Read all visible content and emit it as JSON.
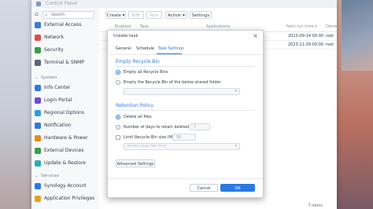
{
  "window": {
    "title": "Control Panel"
  },
  "sidebar": {
    "search_placeholder": "Search",
    "top_items": [
      {
        "label": "External Access",
        "icon": "external-access-icon",
        "color": "#3b7bd6"
      },
      {
        "label": "Network",
        "icon": "network-icon",
        "color": "#e24a4a"
      },
      {
        "label": "Security",
        "icon": "shield-icon",
        "color": "#3a9d4a"
      },
      {
        "label": "Terminal & SNMP",
        "icon": "terminal-icon",
        "color": "#5a6676"
      }
    ],
    "system_section": "System",
    "system_items": [
      {
        "label": "Info Center",
        "icon": "info-icon",
        "color": "#2a7ae2"
      },
      {
        "label": "Login Portal",
        "icon": "login-portal-icon",
        "color": "#6a4fd1"
      },
      {
        "label": "Regional Options",
        "icon": "globe-icon",
        "color": "#2a9fd6"
      },
      {
        "label": "Notification",
        "icon": "notification-icon",
        "color": "#2a7ae2"
      },
      {
        "label": "Hardware & Power",
        "icon": "power-icon",
        "color": "#e38b1e"
      },
      {
        "label": "External Devices",
        "icon": "external-devices-icon",
        "color": "#3a9d4a"
      },
      {
        "label": "Update & Restore",
        "icon": "update-icon",
        "color": "#2ab0b0"
      }
    ],
    "services_section": "Services",
    "services_items": [
      {
        "label": "Synology Account",
        "icon": "synology-account-icon",
        "color": "#2a7ae2"
      },
      {
        "label": "Application Privileges",
        "icon": "app-privileges-icon",
        "color": "#e2a21e"
      }
    ]
  },
  "toolbar": {
    "create": "Create ▾",
    "edit": "Edit",
    "run": "Run",
    "action": "Action ▾",
    "settings": "Settings"
  },
  "grid": {
    "headers": [
      "Enabled",
      "Task",
      "Applications",
      "Next run time ▾",
      "Owner"
    ],
    "rows": [
      {
        "next_run": "2023-09-14 00:00",
        "owner": "root"
      },
      {
        "next_run": "2023-11-29 00:00",
        "owner": "root"
      }
    ],
    "items_count": "7 items"
  },
  "modal": {
    "title": "Create task",
    "tabs": [
      "General",
      "Schedule",
      "Task Settings"
    ],
    "active_tab": "Task Settings",
    "empty_recycle_bin": {
      "heading": "Empty Recycle Bin",
      "option_all": "Empty all Recycle Bins",
      "option_shared": "Empty the Recycle Bin of the below shared folder",
      "shared_folder_placeholder": ""
    },
    "retention_policy": {
      "heading": "Retention Policy",
      "delete_all": "Delete all files",
      "days_label": "Number of days to retain deleted files:",
      "days_value": "7",
      "limit_size_label": "Limit Recycle Bin size (MB):",
      "limit_size_value": "50",
      "delete_rule_placeholder": "Delete large files first"
    },
    "advanced_button": "Advanced Settings",
    "cancel_button": "Cancel",
    "ok_button": "OK"
  },
  "colors": {
    "accent": "#2a7ae2"
  }
}
